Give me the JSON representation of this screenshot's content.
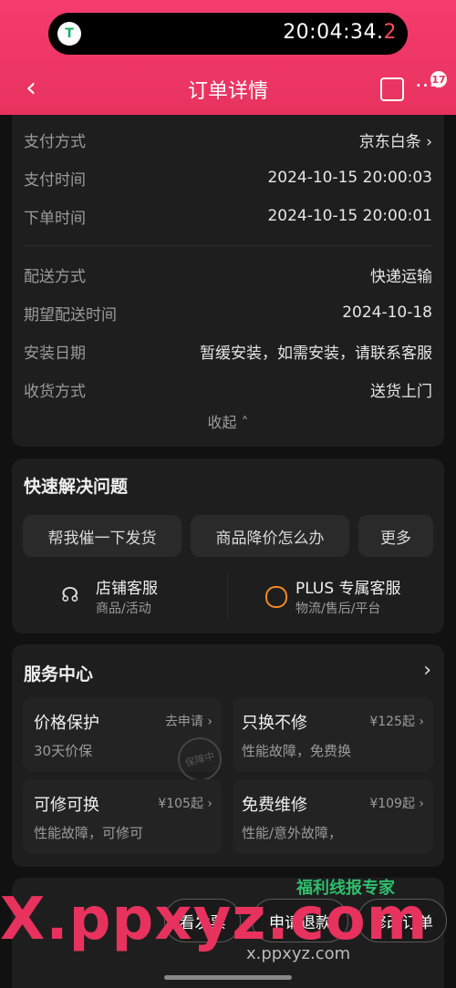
{
  "status": {
    "logo_text": "T",
    "time_main": "20:04:34.",
    "time_ms": "2"
  },
  "nav": {
    "back_icon": "‹",
    "title": "订单详情",
    "more_icon": "···",
    "badge_count": "17"
  },
  "order_info": {
    "payment_method_label": "支付方式",
    "payment_method_value": "京东白条 ›",
    "payment_time_label": "支付时间",
    "payment_time_value": "2024-10-15 20:00:03",
    "order_time_label": "下单时间",
    "order_time_value": "2024-10-15 20:00:01",
    "delivery_method_label": "配送方式",
    "delivery_method_value": "快递运输",
    "expected_time_label": "期望配送时间",
    "expected_time_value": "2024-10-18",
    "install_date_label": "安装日期",
    "install_date_value": "暂缓安装，如需安装，请联系客服",
    "receive_method_label": "收货方式",
    "receive_method_value": "送货上门",
    "collapse_label": "收起 ˄"
  },
  "quick": {
    "title": "快速解决问题",
    "btn1": "帮我催一下发货",
    "btn2": "商品降价怎么办",
    "btn3": "更多",
    "store_service": "店铺客服",
    "store_service_sub": "商品/活动",
    "plus_service": "PLUS 专属客服",
    "plus_service_sub": "物流/售后/平台"
  },
  "service_center": {
    "title": "服务中心",
    "items": [
      {
        "name": "价格保护",
        "sub": "30天价保",
        "price": "去申请 ›"
      },
      {
        "name": "只换不修",
        "sub": "性能故障，免费换",
        "price": "¥125起 ›"
      },
      {
        "name": "可修可换",
        "sub": "性能故障，可修可",
        "price": "¥105起 ›"
      },
      {
        "name": "免费维修",
        "sub": "性能/意外故障，",
        "price": "¥109起 ›"
      }
    ],
    "stamp": "保障中"
  },
  "bottom": {
    "btn1": "看发票",
    "btn2": "申请退款",
    "btn3": "修改订单"
  },
  "watermark": {
    "big": "X.ppxyz.com",
    "small": "x.ppxyz.com",
    "brand": "福利线报专家"
  }
}
